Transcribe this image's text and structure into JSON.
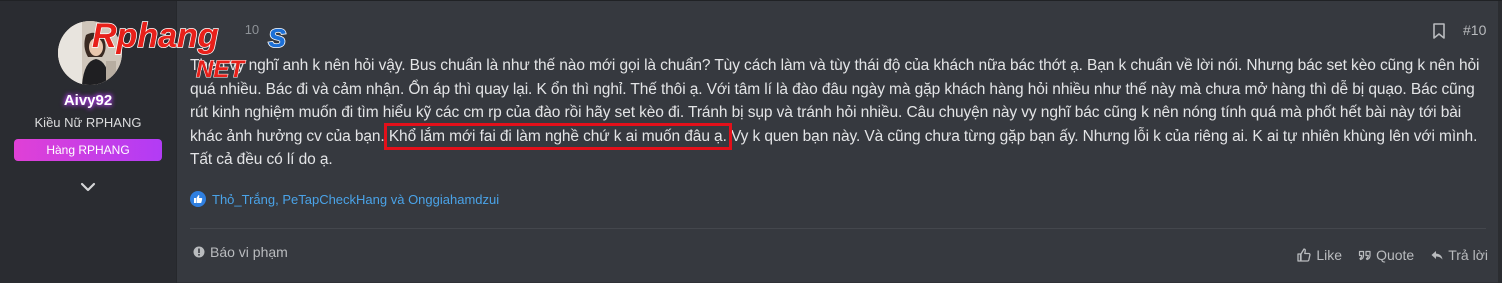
{
  "watermark": {
    "brand": "Rphang",
    "suffix": "s",
    "net": "NET"
  },
  "user": {
    "name": "Aivy92",
    "title": "Kiều Nữ RPHANG",
    "rank": "Hàng RPHANG"
  },
  "post": {
    "date_fragment": "10",
    "number": "#10",
    "text_before": "Theo vy nghĩ anh k nên hỏi vậy. Bus chuẩn là như thế nào mới gọi là chuẩn? Tùy cách làm và tùy thái độ của khách nữa bác thớt ạ. Bạn k chuẩn về lời nói. Nhưng bác set kèo cũng k nên hỏi quá nhiều. Bác đi và cảm nhận. Ổn áp thì quay lại. K ổn thì nghỉ. Thế thôi ạ. Với tâm lí là đào đâu ngày mà gặp khách hàng hỏi nhiều như thế này mà chưa mở hàng thì dễ bị quạo. Bác cũng rút kinh nghiệm muốn đi tìm hiểu kỹ các cm rp của đào rồi hãy set kèo đi. Tránh bị sụp và tránh hỏi nhiều. Câu chuyện này vy nghĩ bác cũng k nên nóng tính quá mà phốt hết bài này tới bài khác ảnh hưởng cv của bạn. ",
    "text_highlight": "Khổ lắm mới fai đi làm nghề chứ k ai muốn đâu ạ.",
    "text_after": " Vy k quen bạn này. Và cũng chưa từng gặp bạn ấy. Nhưng lỗi k của riêng ai. K ai tự nhiên khùng lên với mình. Tất cả đều có lí do ạ.",
    "reactions": "Thỏ_Trắng, PeTapCheckHang và Onggiahamdzui"
  },
  "footer": {
    "report": "Báo vi phạm",
    "like": "Like",
    "quote": "Quote",
    "reply": "Trả lời"
  },
  "colors": {
    "background": "#36393f",
    "user_column": "#2a2c31",
    "text": "#e3e4e6",
    "link": "#4aa3e8",
    "highlight_border": "#e3101a",
    "rank_badge": "#d946ef",
    "watermark_red": "#e8201a",
    "watermark_blue": "#1c6fd6"
  },
  "icons": [
    "avatar-photo",
    "chevron-down-icon",
    "bookmark-icon",
    "thumbs-up-icon",
    "alert-circle-icon",
    "like-icon",
    "quote-icon",
    "reply-icon"
  ]
}
